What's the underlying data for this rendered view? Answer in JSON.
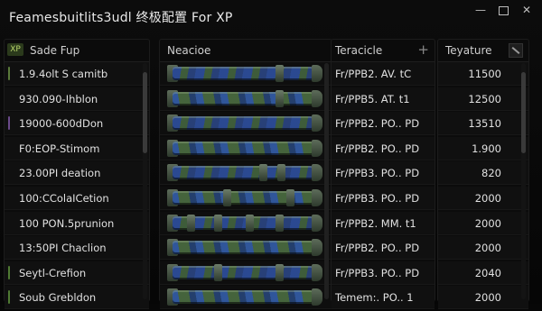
{
  "window": {
    "title": "Feamesbuitlits3udl 终极配置 For XP",
    "minimize_glyph": "—",
    "close_glyph": "✕"
  },
  "left_panel": {
    "badge": "XP",
    "header": "Sade Fup",
    "rows": [
      {
        "label": "1.9.4olt S camitb",
        "marker": "#5a7a3a"
      },
      {
        "label": "930.090-Ihblon",
        "marker": ""
      },
      {
        "label": "19000-600dDon",
        "marker": "#6a4a8a"
      },
      {
        "label": "F0:EOP-Stimom",
        "marker": ""
      },
      {
        "label": "23.00PI deation",
        "marker": ""
      },
      {
        "label": "100:CColaICetion",
        "marker": ""
      },
      {
        "label": "100 PON.5prunion",
        "marker": ""
      },
      {
        "label": "13:50PI Chaclion",
        "marker": ""
      },
      {
        "label": "Seytl-Crefion",
        "marker": "#4f7a32"
      },
      {
        "label": "Soub Grebldon",
        "marker": "#4f7a32"
      }
    ]
  },
  "mid_panel": {
    "header": "Neacioe",
    "row_count": 10
  },
  "attr_panel": {
    "header": "Teracicle",
    "add_icon": "+",
    "rows": [
      "Fr/PPB2. AV. tC",
      "Fr/PPB5. AT. t1",
      "Fr/PPB2. PO.. PD",
      "Fr/PPB2. PO.. PD",
      "Fr/PPB3. PO.. PD",
      "Fr/PPB3. PO.. PD",
      "Fr/PPB2. MM. t1",
      "Fr/PPB2. PO.. PD",
      "Fr/PPB3. PO.. PD",
      "Temem:. PO.. 1"
    ]
  },
  "value_panel": {
    "header": "Teyature",
    "rows": [
      "11500",
      "12500",
      "13510",
      "1.900",
      "820",
      "2000",
      "2000",
      "2000",
      "2040",
      "2000"
    ]
  },
  "colors": {
    "background": "#070707",
    "accent_green": "#b6d36a",
    "pipe_blue": "#28469f",
    "pipe_green": "#3e5c3a"
  }
}
